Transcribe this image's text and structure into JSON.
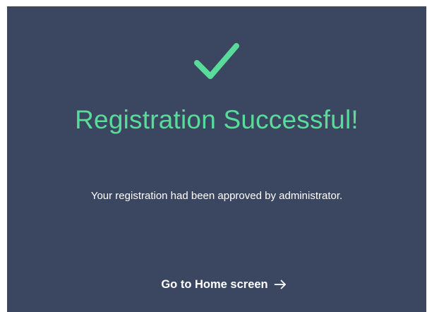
{
  "success_icon": "checkmark-icon",
  "title": "Registration Successful!",
  "message": "Your registration had been approved by administrator.",
  "home_link": {
    "label": "Go to Home screen",
    "icon": "arrow-right-icon"
  },
  "colors": {
    "panel_background": "#3b4761",
    "accent": "#59db9a",
    "text": "#ffffff"
  }
}
